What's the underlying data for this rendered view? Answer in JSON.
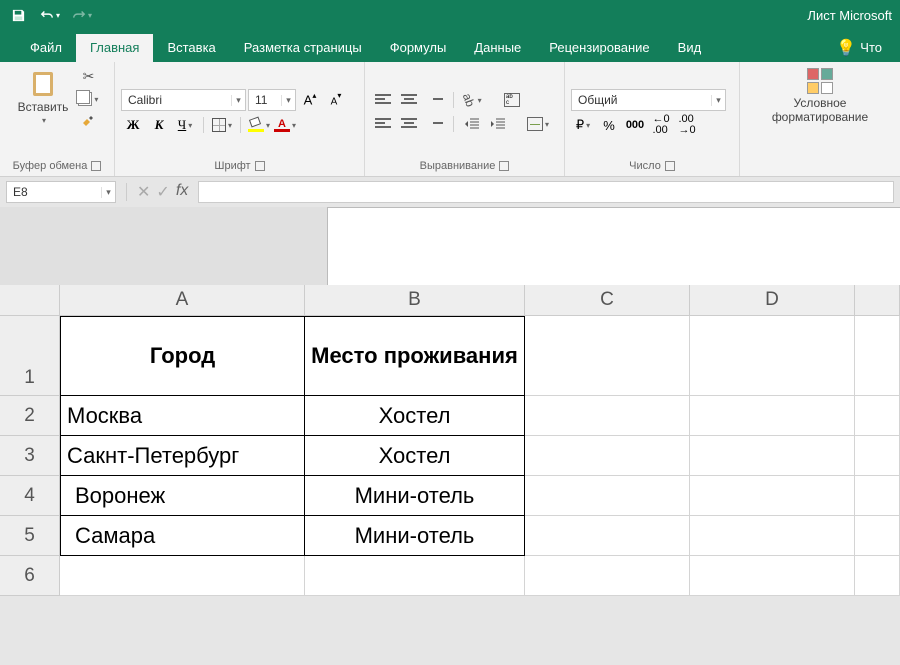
{
  "app": {
    "title": "Лист Microsoft"
  },
  "qat": {
    "save": "save-icon",
    "undo": "undo-icon",
    "redo": "redo-icon"
  },
  "tabs": {
    "file": "Файл",
    "items": [
      {
        "label": "Главная",
        "active": true
      },
      {
        "label": "Вставка"
      },
      {
        "label": "Разметка страницы"
      },
      {
        "label": "Формулы"
      },
      {
        "label": "Данные"
      },
      {
        "label": "Рецензирование"
      },
      {
        "label": "Вид"
      }
    ],
    "tell_me": "Что"
  },
  "ribbon": {
    "clipboard": {
      "paste": "Вставить",
      "label": "Буфер обмена"
    },
    "font": {
      "name": "Calibri",
      "size": "11",
      "bold": "Ж",
      "italic": "К",
      "underline": "Ч",
      "label": "Шрифт"
    },
    "alignment": {
      "label": "Выравнивание"
    },
    "number": {
      "format": "Общий",
      "currency": "₽",
      "percent": "%",
      "comma": "000",
      "dec_inc": "←0 .00",
      "dec_dec": ".00 →0",
      "label": "Число"
    },
    "cond_format": {
      "line1": "Условное",
      "line2": "форматирование"
    }
  },
  "fx": {
    "name_box": "E8",
    "fx_label": "fx"
  },
  "grid": {
    "columns": [
      "A",
      "B",
      "C",
      "D"
    ],
    "rows": [
      "1",
      "2",
      "3",
      "4",
      "5",
      "6"
    ],
    "cells": {
      "A1": "Город",
      "B1": "Место проживания",
      "A2": "Москва",
      "B2": "Хостел",
      "A3": "Сакнт-Петербург",
      "B3": "Хостел",
      "A4": "Воронеж",
      "B4": "Мини-отель",
      "A5": "Самара",
      "B5": "Мини-отель"
    }
  }
}
